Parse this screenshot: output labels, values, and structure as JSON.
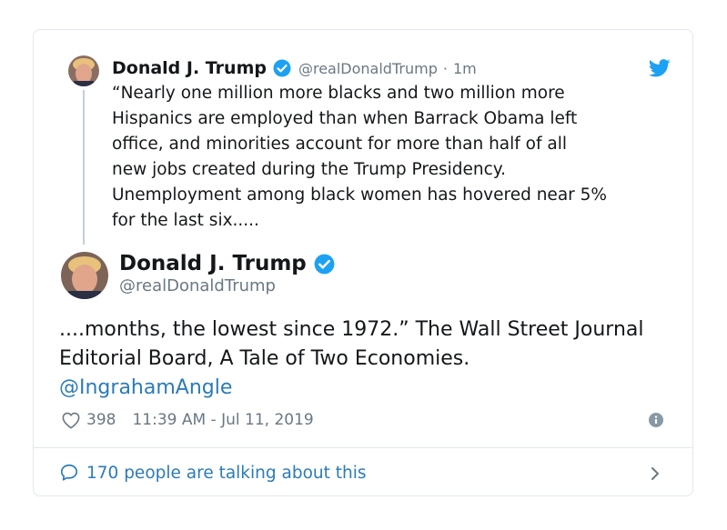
{
  "quoted_tweet": {
    "author_name": "Donald J. Trump",
    "handle": "@realDonaldTrump",
    "separator": "·",
    "time": "1m",
    "text": "“Nearly one million more blacks and two million more\nHispanics are employed than when Barrack Obama left\noffice, and minorities account for more than half of all\nnew jobs created during the Trump Presidency.\nUnemployment among black women has hovered near 5%\nfor the last six....."
  },
  "main_tweet": {
    "author_name": "Donald J. Trump",
    "handle": "@realDonaldTrump",
    "text": "....months, the lowest since 1972.” The Wall Street Journal Editorial Board, A Tale of Two Economies.",
    "mention": "@IngrahamAngle",
    "like_count": "398",
    "timestamp": "11:39 AM - Jul 11, 2019"
  },
  "footer": {
    "conversation_label": "170 people are talking about this"
  },
  "colors": {
    "twitter_blue": "#1da1f2",
    "link_blue": "#2b7bb9",
    "muted_gray": "#697882",
    "border": "#e1e8ed"
  },
  "icons": {
    "brand": "twitter-bird-icon",
    "verified": "verified-badge-icon",
    "like": "heart-icon",
    "info": "info-icon",
    "reply": "speech-bubble-icon",
    "more": "chevron-right-icon"
  }
}
